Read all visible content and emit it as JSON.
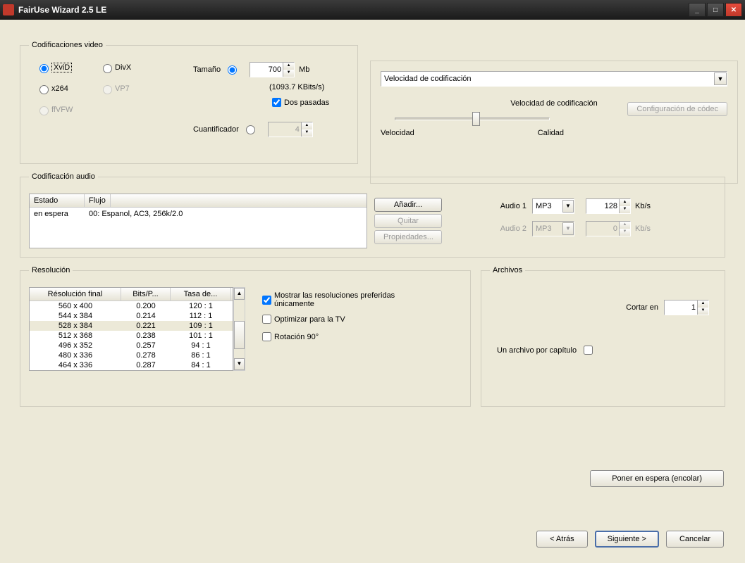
{
  "window": {
    "title": "FairUse Wizard 2.5 LE"
  },
  "video": {
    "legend": "Codificaciones video",
    "codecs": {
      "xvid": "XviD",
      "divx": "DivX",
      "x264": "x264",
      "vp7": "VP7",
      "ffvfw": "ffVFW"
    },
    "size_label": "Tamaño",
    "size_value": "700",
    "size_unit": "Mb",
    "bitrate": "(1093.7 KBits/s)",
    "two_pass": "Dos pasadas",
    "quant_label": "Cuantificador",
    "quant_value": "4"
  },
  "speed": {
    "dropdown": "Velocidad de codificación",
    "label": "Velocidad de codificación",
    "left": "Velocidad",
    "right": "Calidad",
    "codec_btn": "Configuración de códec"
  },
  "audio": {
    "legend": "Codificación audio",
    "col_state": "Estado",
    "col_stream": "Flujo",
    "row_state": "en espera",
    "row_stream": "00: Espanol, AC3, 256k/2.0",
    "btn_add": "Añadir...",
    "btn_remove": "Quitar",
    "btn_props": "Propiedades...",
    "a1_label": "Audio 1",
    "a1_codec": "MP3",
    "a1_kbps": "128",
    "kbps_unit": "Kb/s",
    "a2_label": "Audio 2",
    "a2_codec": "MP3",
    "a2_kbps": "0"
  },
  "resolution": {
    "legend": "Resolución",
    "col1": "Résolución final",
    "col2": "Bits/P...",
    "col3": "Tasa de...",
    "rows": [
      {
        "r": "560 x 400",
        "b": "0.200",
        "t": "120 : 1"
      },
      {
        "r": "544 x 384",
        "b": "0.214",
        "t": "112 : 1"
      },
      {
        "r": "528 x 384",
        "b": "0.221",
        "t": "109 : 1"
      },
      {
        "r": "512 x 368",
        "b": "0.238",
        "t": "101 : 1"
      },
      {
        "r": "496 x 352",
        "b": "0.257",
        "t": "94 : 1"
      },
      {
        "r": "480 x 336",
        "b": "0.278",
        "t": "86 : 1"
      },
      {
        "r": "464 x 336",
        "b": "0.287",
        "t": "84 : 1"
      }
    ],
    "chk_pref": "Mostrar las resoluciones preferidas únicamente",
    "chk_tv": "Optimizar para la TV",
    "chk_rot": "Rotación 90°"
  },
  "files": {
    "legend": "Archivos",
    "cut_label": "Cortar en",
    "cut_value": "1",
    "per_chapter": "Un archivo por capítulo"
  },
  "queue_btn": "Poner en espera (encolar)",
  "nav": {
    "back": "< Atrás",
    "next": "Siguiente >",
    "cancel": "Cancelar"
  }
}
